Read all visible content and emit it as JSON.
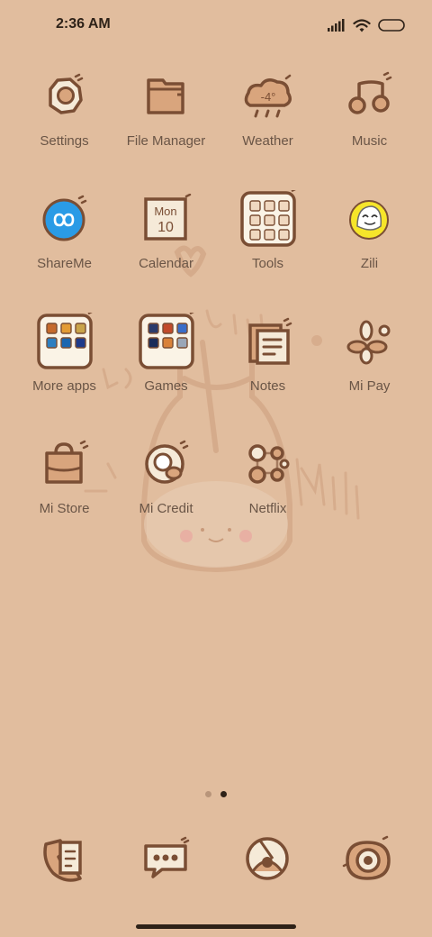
{
  "status_bar": {
    "time": "2:36 AM",
    "icons": [
      "signal-icon",
      "wifi-icon",
      "battery-icon"
    ]
  },
  "apps": [
    {
      "label": "Settings",
      "icon": "gear-icon"
    },
    {
      "label": "File Manager",
      "icon": "folder-icon"
    },
    {
      "label": "Weather",
      "icon": "cloud-icon",
      "temp": "-4°"
    },
    {
      "label": "Music",
      "icon": "music-note-icon"
    },
    {
      "label": "ShareMe",
      "icon": "infinity-icon"
    },
    {
      "label": "Calendar",
      "icon": "calendar-icon",
      "day": "Mon",
      "date": "10"
    },
    {
      "label": "Tools",
      "icon": "tools-folder-icon"
    },
    {
      "label": "Zili",
      "icon": "zili-face-icon"
    },
    {
      "label": "More apps",
      "icon": "more-apps-folder-icon"
    },
    {
      "label": "Games",
      "icon": "games-folder-icon"
    },
    {
      "label": "Notes",
      "icon": "notes-icon"
    },
    {
      "label": "Mi Pay",
      "icon": "mi-pay-icon"
    },
    {
      "label": "Mi Store",
      "icon": "shopping-bag-icon"
    },
    {
      "label": "Mi Credit",
      "icon": "mi-credit-icon"
    },
    {
      "label": "Netflix",
      "icon": "netflix-icon"
    }
  ],
  "page_indicator": {
    "count": 2,
    "active": 2
  },
  "dock": [
    {
      "icon": "phone-icon"
    },
    {
      "icon": "messages-icon"
    },
    {
      "icon": "browser-icon"
    },
    {
      "icon": "camera-icon"
    }
  ],
  "colors": {
    "background": "#e1bd9e",
    "icon_stroke": "#7a4e34",
    "icon_fill": "#d9a57d",
    "label": "#6a5546",
    "shareme_blue": "#2a9be6",
    "zili_yellow": "#f6e52a"
  }
}
